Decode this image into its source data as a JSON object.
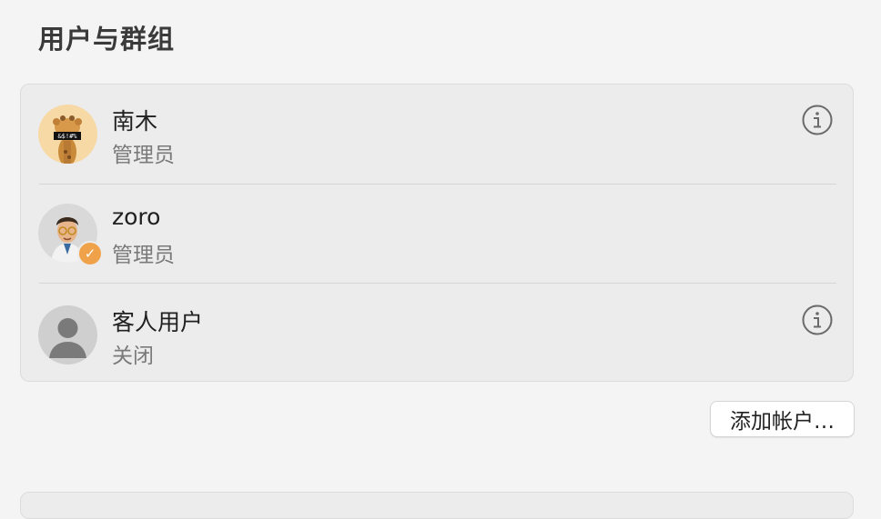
{
  "page": {
    "title": "用户与群组"
  },
  "users": [
    {
      "name": "南木",
      "role": "管理员",
      "avatar_label": "&$!#%",
      "has_info": true
    },
    {
      "name": "zoro",
      "role": "管理员",
      "badge": "✓",
      "has_info": false
    },
    {
      "name": "客人用户",
      "role": "关闭",
      "has_info": true
    }
  ],
  "actions": {
    "add_account_label": "添加帐户…"
  },
  "colors": {
    "badge": "#f0a24a",
    "panel": "#ececec",
    "background": "#f5f4f4"
  },
  "icons": {
    "info": "info-circle-icon",
    "guest": "person-silhouette-icon"
  }
}
